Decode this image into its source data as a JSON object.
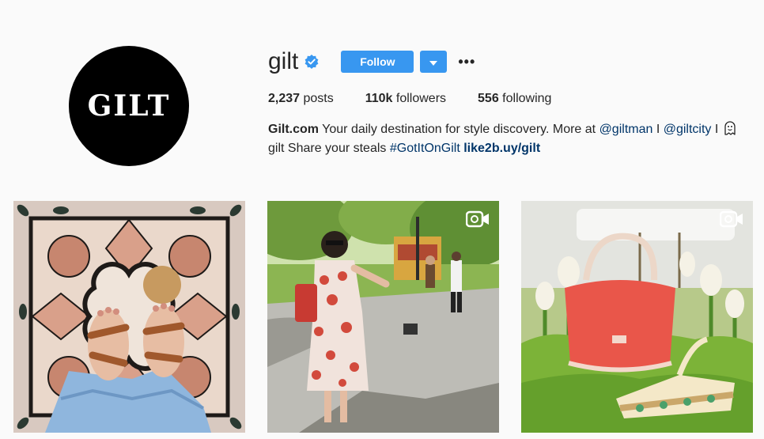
{
  "profile": {
    "username": "gilt",
    "avatar_text": "GILT",
    "follow_label": "Follow",
    "more_icon": "•••",
    "stats": {
      "posts_count": "2,237",
      "posts_label": " posts",
      "followers_count": "110k",
      "followers_label": " followers",
      "following_count": "556",
      "following_label": " following"
    },
    "bio": {
      "name": "Gilt.com",
      "text1": " Your daily destination for style discovery. More at ",
      "mention1": "@giltman",
      "sep1": " I ",
      "mention2": "@giltcity",
      "sep2": " I ",
      "text2": "gilt Share your steals ",
      "hashtag": "#GotItOnGilt",
      "space": " ",
      "link": "like2b.uy/gilt"
    }
  },
  "colors": {
    "accent": "#3897f0",
    "background": "#fafafa",
    "text": "#262626",
    "link": "#003569"
  },
  "posts": [
    {
      "subject": "feet in sandals on marble floor",
      "is_video": false
    },
    {
      "subject": "woman in floral dress in park",
      "is_video": true
    },
    {
      "subject": "orange handbag and sandals on grass",
      "is_video": true
    }
  ]
}
